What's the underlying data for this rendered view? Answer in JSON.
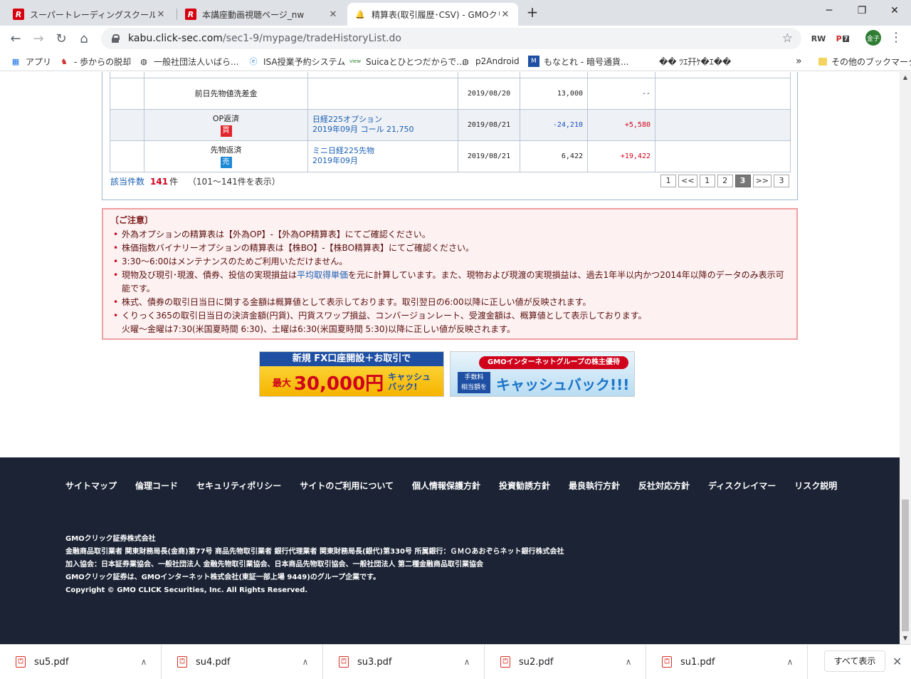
{
  "tabs": [
    {
      "title": "スーパートレーディングスクールREED KE",
      "icon": "reed-r-icon"
    },
    {
      "title": "本講座動画視聴ページ_nw",
      "icon": "reed-r-icon"
    },
    {
      "title": "精算表(取引履歴･CSV) - GMOクリ",
      "icon": "bell-icon"
    }
  ],
  "tab_close_glyph": "✕",
  "new_tab_glyph": "+",
  "window": {
    "minimize": "─",
    "maximize": "❐",
    "close": "✕"
  },
  "nav": {
    "back": "←",
    "forward": "→",
    "reload": "↻",
    "home": "⌂"
  },
  "address": {
    "host": "kabu.click-sec.com",
    "path": "/sec1-9/mypage/tradeHistoryList.do"
  },
  "toolbar_icons": {
    "bookmark_star": "☆",
    "ext1": "RW",
    "ext2": "P",
    "ext2_badge": "7",
    "profile": "金子",
    "menu": "⋮"
  },
  "bookmarks": [
    {
      "label": "アプリ",
      "icon": "apps-grid-icon"
    },
    {
      "label": "- 歩からの脱却",
      "icon": "bookmark-favicon"
    },
    {
      "label": "一般社団法人いばら...",
      "icon": "globe-icon"
    },
    {
      "label": "ISA授業予約システム",
      "icon": "ie-icon"
    },
    {
      "label": "Suicaとひとつだからで...",
      "icon": "view-icon"
    },
    {
      "label": "p2Android",
      "icon": "globe-icon"
    },
    {
      "label": "もなとれ - 暗号通貨...",
      "icon": "monatore-icon"
    },
    {
      "label": "�� ﾂｴ幵ｹ�ｴ��",
      "icon": "blank-icon"
    }
  ],
  "bookmarks_more": "»",
  "bookmarks_other": "その他のブックマーク",
  "trades": [
    {
      "type": "前日先物値洗差金",
      "badge": "",
      "name1": "",
      "name2": "",
      "date": "2019/08/20",
      "amount": "13,000",
      "pl": "--",
      "pl_class": "",
      "amount_class": ""
    },
    {
      "type": "OP返済",
      "badge": "買",
      "badge_class": "buy",
      "name1": "日経225オプション",
      "name2": "2019年09月 コール 21,750",
      "date": "2019/08/21",
      "amount": "-24,210",
      "pl": "+5,580",
      "pl_class": "pos",
      "amount_class": "neg"
    },
    {
      "type": "先物返済",
      "badge": "売",
      "badge_class": "sell",
      "name1": "ミニ日経225先物",
      "name2": "2019年09月",
      "date": "2019/08/21",
      "amount": "6,422",
      "pl": "+19,422",
      "pl_class": "pos",
      "amount_class": ""
    }
  ],
  "summary": {
    "label": "該当件数",
    "count": "141",
    "unit": "件",
    "range": "（101～141件を表示）"
  },
  "pager": [
    "1",
    "<<",
    "1",
    "2",
    "3",
    ">>",
    "3"
  ],
  "pager_current_index": 4,
  "notice": {
    "title": "〔ご注意〕",
    "items": [
      {
        "text": "外為オプションの精算表は【外為OP】-【外為OP精算表】にてご確認ください。"
      },
      {
        "text": "株価指数バイナリーオプションの精算表は【株BO】-【株BO精算表】にてご確認ください。"
      },
      {
        "text": "3:30～6:00はメンテナンスのためご利用いただけません。"
      },
      {
        "pre": "現物及び現引･現渡、債券、投信の実現損益は",
        "link": "平均取得単価",
        "post": "を元に計算しています。また、現物および現渡の実現損益は、過去1年半以内かつ2014年以降のデータのみ表示可能です。"
      },
      {
        "text": "株式、債券の取引日当日に関する金額は概算値として表示しております。取引翌日の6:00以降に正しい値が反映されます。"
      },
      {
        "text": "くりっく365の取引日当日の決済金額(円貨)、円貨スワップ損益、コンバージョンレート、受渡金額は、概算値として表示しております。",
        "line2": "火曜～金曜は7:30(米国夏時間 6:30)、土曜は6:30(米国夏時間 5:30)以降に正しい値が反映されます。"
      }
    ]
  },
  "banner_fx": {
    "top": "新規 FX口座開設＋お取引で",
    "prefix": "最大",
    "amount": "30,000円",
    "suffix1": "キャッシュ",
    "suffix2": "バック!"
  },
  "banner_gmo": {
    "top": "GMOインターネットグループの株主優待",
    "sub1": "手数料",
    "sub2": "相当額を",
    "main": "キャッシュバック!!!"
  },
  "footer": {
    "links": [
      "サイトマップ",
      "倫理コード",
      "セキュリティポリシー",
      "サイトのご利用について",
      "個人情報保護方針",
      "投資勧誘方針",
      "最良執行方針",
      "反社対応方針",
      "ディスクレイマー",
      "リスク説明"
    ],
    "lines": [
      "GMOクリック証券株式会社",
      "金融商品取引業者 関東財務局長(金商)第77号 商品先物取引業者 銀行代理業者 関東財務局長(銀代)第330号 所属銀行：ＧＭＯあおぞらネット銀行株式会社",
      "加入協会：日本証券業協会、一般社団法人 金融先物取引業協会、日本商品先物取引協会、一般社団法人 第二種金融商品取引業協会",
      "GMOクリック証券は、GMOインターネット株式会社(東証一部上場 9449)のグループ企業です。",
      "Copyright © GMO CLICK Securities, Inc. All Rights Reserved."
    ]
  },
  "downloads": [
    {
      "name": "su5.pdf"
    },
    {
      "name": "su4.pdf"
    },
    {
      "name": "su3.pdf"
    },
    {
      "name": "su2.pdf"
    },
    {
      "name": "su1.pdf"
    }
  ],
  "download_chevron": "∧",
  "show_all": "すべて表示",
  "shelf_close": "✕"
}
